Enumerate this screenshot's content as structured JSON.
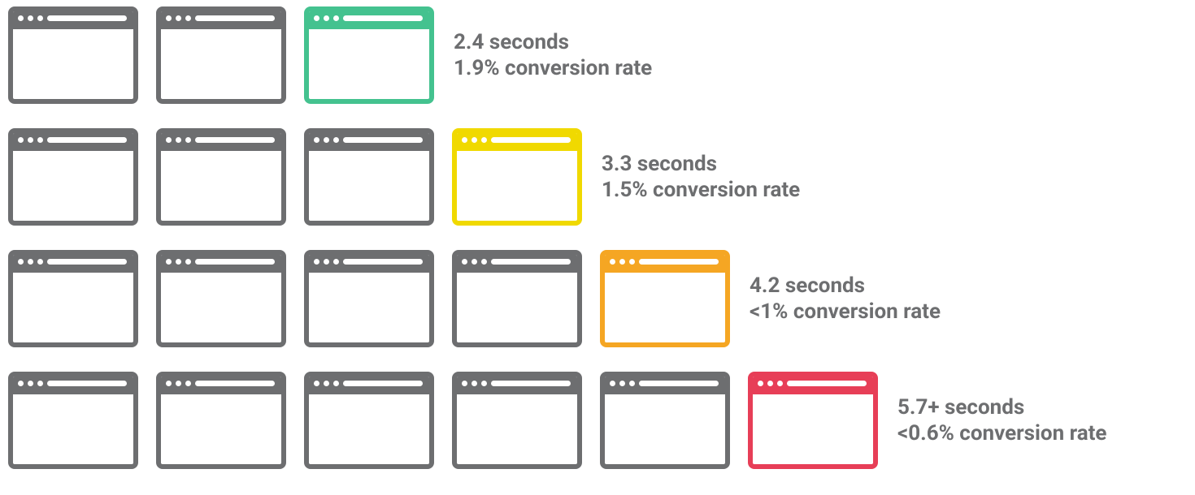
{
  "chart_data": {
    "type": "diagram",
    "rows": [
      {
        "gray_windows": 2,
        "highlight_color": "green",
        "seconds_label": "2.4 seconds",
        "conversion_label": "1.9% conversion rate"
      },
      {
        "gray_windows": 3,
        "highlight_color": "yellow",
        "seconds_label": "3.3 seconds",
        "conversion_label": "1.5% conversion rate"
      },
      {
        "gray_windows": 4,
        "highlight_color": "orange",
        "seconds_label": "4.2 seconds",
        "conversion_label": "<1% conversion rate"
      },
      {
        "gray_windows": 5,
        "highlight_color": "red",
        "seconds_label": "5.7+ seconds",
        "conversion_label": "<0.6% conversion rate"
      }
    ],
    "colors": {
      "gray": "#6d6e70",
      "green": "#44c28f",
      "yellow": "#f0d900",
      "orange": "#f5a623",
      "red": "#e73e57"
    }
  }
}
